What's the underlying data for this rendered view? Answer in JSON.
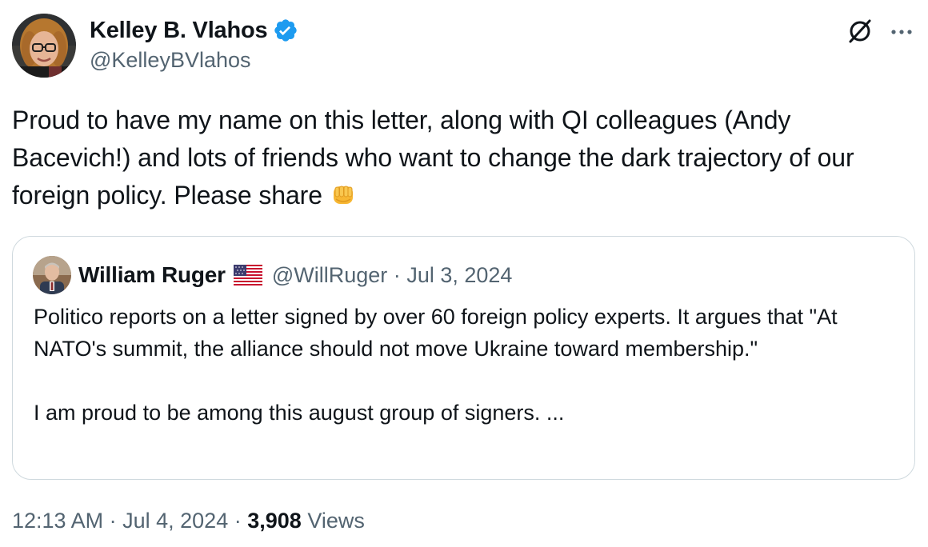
{
  "author": {
    "name": "Kelley B. Vlahos",
    "handle": "@KelleyBVlahos",
    "verified": true,
    "verified_color": "#1d9bf0"
  },
  "tweet": {
    "text": "Proud to have my name on this letter, along with QI colleagues (Andy Bacevich!) and lots of friends who want to change the dark trajectory of our foreign policy. Please share",
    "emoji_icon": "oncoming-fist-emoji"
  },
  "quote": {
    "author_name": "William Ruger",
    "flag_icon": "us-flag-emoji",
    "handle": "@WillRuger",
    "separator": "·",
    "date": "Jul 3, 2024",
    "paragraph1": "Politico reports on a letter signed by over 60 foreign policy experts. It argues that \"At NATO's summit, the alliance should not move Ukraine toward membership.\"",
    "paragraph2": "I am proud to be among this august group of signers. ..."
  },
  "footer": {
    "time": "12:13 AM",
    "separator1": "·",
    "date": "Jul 4, 2024",
    "separator2": "·",
    "views_count": "3,908",
    "views_label": "Views"
  },
  "icons": {
    "grok": "grok-icon",
    "more": "more-options-icon"
  },
  "colors": {
    "text_primary": "#0f1419",
    "text_secondary": "#536471",
    "border": "#cfd9de",
    "accent": "#1d9bf0"
  }
}
